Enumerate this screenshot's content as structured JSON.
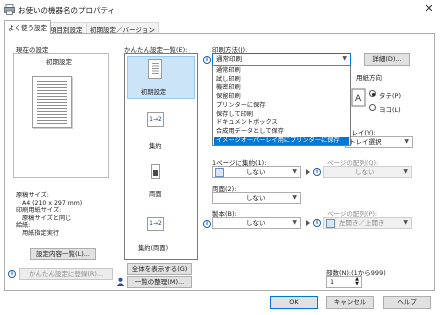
{
  "window": {
    "title": "お使いの機器名のプロパティ",
    "close_glyph": "✕"
  },
  "tabs": [
    {
      "label": "よく使う設定"
    },
    {
      "label": "項目別設定"
    },
    {
      "label": "初期設定／バージョン"
    }
  ],
  "current": {
    "heading": "現在の設定",
    "preset_label": "初期設定",
    "lines": [
      "原稿サイズ:",
      "A4 (210 x 297 mm)",
      "印刷用紙サイズ:",
      "原稿サイズと同じ",
      "給紙:",
      "用紙指定実行"
    ],
    "settings_list_button": "設定内容一覧(L)...",
    "register_button": "かんたん設定に登録(R)..."
  },
  "presets": {
    "heading": "かんたん設定一覧(E):",
    "items": [
      {
        "name": "初期設定",
        "thumb": ""
      },
      {
        "name": "集約",
        "thumb": "1→2"
      },
      {
        "name": "両面",
        "thumb": ""
      },
      {
        "name": "集約(両面)",
        "thumb": "1→2"
      }
    ],
    "save_all_button": "全体を表示する(G)",
    "organize_button": "一覧の整理(M)..."
  },
  "print_method": {
    "label": "印刷方法(J):",
    "value": "通常印刷",
    "detail_button": "詳細(D)...",
    "options": [
      "通常印刷",
      "試し印刷",
      "機密印刷",
      "保留印刷",
      "プリンターに保存",
      "保存して印刷",
      "ドキュメントボックス",
      "合成用データとして保存",
      "イメージオーバーレイ用にプリンターに保存"
    ],
    "selected_index": 8
  },
  "orientation": {
    "label": "用紙方向",
    "portrait": "タテ(P)",
    "landscape": "ヨコ(L)"
  },
  "tray": {
    "label": "トレイ(Y):",
    "value": "トレイ選択"
  },
  "nup": {
    "label": "1ページに集約(1):",
    "value": "しない"
  },
  "page_order": {
    "label": "ページの配列(Q):",
    "value": "しない"
  },
  "duplex": {
    "label": "両面(2):",
    "value": "しない"
  },
  "binding": {
    "label": "製本(B):",
    "value": "しない"
  },
  "binding_layout": {
    "label": "ページの配列(P):",
    "value": "左開き／上開き"
  },
  "copies": {
    "label": "部数(N):(1から999)",
    "value": "1"
  },
  "footer": {
    "ok": "OK",
    "cancel": "キャンセル",
    "help": "ヘルプ"
  }
}
